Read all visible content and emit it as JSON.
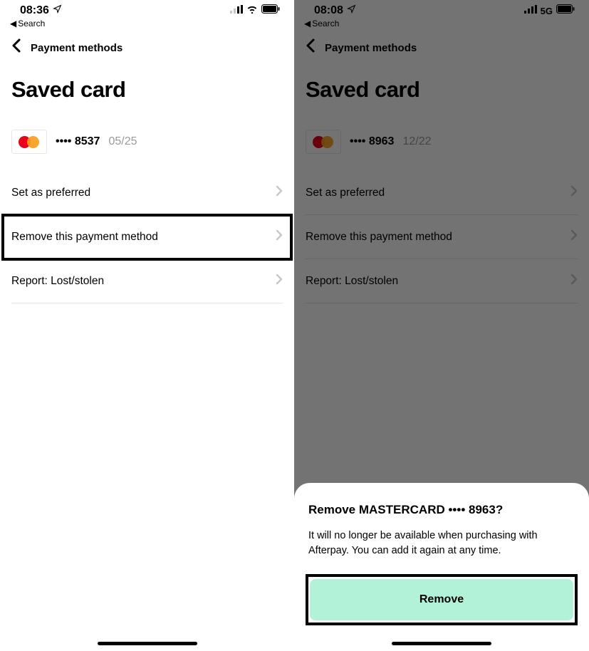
{
  "left": {
    "statusbar": {
      "time": "08:36",
      "back_label": "Search"
    },
    "header": {
      "label": "Payment methods"
    },
    "title": "Saved card",
    "card": {
      "masked": "•••• 8537",
      "expiry": "05/25"
    },
    "menu": {
      "set_preferred": "Set as preferred",
      "remove": "Remove this payment method",
      "report": "Report: Lost/stolen"
    }
  },
  "right": {
    "statusbar": {
      "time": "08:08",
      "net": "5G",
      "back_label": "Search"
    },
    "header": {
      "label": "Payment methods"
    },
    "title": "Saved card",
    "card": {
      "masked": "•••• 8963",
      "expiry": "12/22"
    },
    "menu": {
      "set_preferred": "Set as preferred",
      "remove": "Remove this payment method",
      "report": "Report: Lost/stolen"
    },
    "sheet": {
      "title": "Remove MASTERCARD •••• 8963?",
      "body": "It will no longer be available when purchasing with Afterpay. You can add it again at any time.",
      "button": "Remove"
    }
  }
}
